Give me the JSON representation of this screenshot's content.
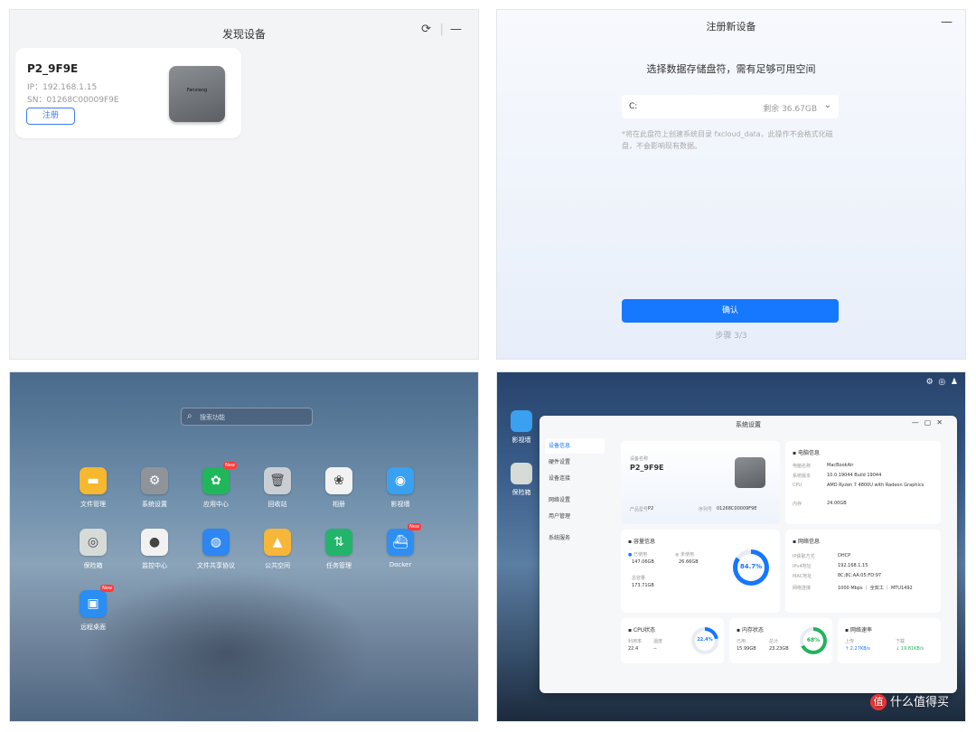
{
  "discover": {
    "title": "发现设备",
    "device_name": "P2_9F9E",
    "ip": "IP：192.168.1.15",
    "sn": "SN：01268C00009F9E",
    "register_label": "注册",
    "device_brand": "Fanxiang"
  },
  "register": {
    "title": "注册新设备",
    "prompt": "选择数据存储盘符，需有足够可用空间",
    "drive": "C:",
    "remaining": "剩余 36.67GB",
    "note": "*将在此盘符上创建系统目录 fxcloud_data，此操作不会格式化磁盘，不会影响现有数据。",
    "confirm_label": "确认",
    "step": "步骤 3/3"
  },
  "launcher": {
    "search_placeholder": "搜索功能",
    "apps": [
      {
        "label": "文件管理",
        "color": "#f5b82e",
        "glyph": "▬"
      },
      {
        "label": "系统设置",
        "color": "#8f949b",
        "glyph": "⚙"
      },
      {
        "label": "应用中心",
        "color": "#1fb75a",
        "glyph": "✿",
        "badge": "New"
      },
      {
        "label": "回收站",
        "color": "#c9ced5",
        "glyph": "🗑"
      },
      {
        "label": "相册",
        "color": "#f2f2f2",
        "glyph": "❀"
      },
      {
        "label": "影视墙",
        "color": "#3aa0f0",
        "glyph": "◉"
      },
      {
        "label": "保险箱",
        "color": "#d6dbd8",
        "glyph": "◎"
      },
      {
        "label": "监控中心",
        "color": "#f1f1f1",
        "glyph": "●"
      },
      {
        "label": "文件共享协议",
        "color": "#2e86f0",
        "glyph": "◍"
      },
      {
        "label": "公共空间",
        "color": "#f6b63a",
        "glyph": "▲"
      },
      {
        "label": "任务管理",
        "color": "#23b36b",
        "glyph": "⇅"
      },
      {
        "label": "Docker",
        "color": "#2e8ff0",
        "glyph": "⛴",
        "badge": "New"
      },
      {
        "label": "远程桌面",
        "color": "#2a8ef2",
        "glyph": "▣",
        "badge": "New"
      }
    ]
  },
  "settings": {
    "desktop_icons": [
      {
        "label": "影视墙",
        "color": "#3aa0f0"
      },
      {
        "label": "保险箱",
        "color": "#d6dbd8"
      }
    ],
    "window_title": "系统设置",
    "nav": [
      "设备信息",
      "硬件设置",
      "设备连接",
      "网络设置",
      "用户管理",
      "系统服务"
    ],
    "device": {
      "label": "设备名称",
      "name": "P2_9F9E",
      "model_label": "产品型号",
      "model": "P2",
      "serial_label": "序列号",
      "serial": "01268C00009F9E"
    },
    "computer": {
      "title": "电脑信息",
      "rows": [
        {
          "k": "电脑名称",
          "v": "MacBookAir"
        },
        {
          "k": "系统版本",
          "v": "10.0.19044 Build 19044"
        },
        {
          "k": "CPU",
          "v": "AMD Ryzen 7 4800U with Radeon Graphics"
        },
        {
          "k": "内存",
          "v": "24.00GB"
        }
      ]
    },
    "storage": {
      "title": "容量信息",
      "used_label": "已使用",
      "used": "147.06GB",
      "free_label": "未使用",
      "free": "26.66GB",
      "total_label": "总容量",
      "total": "173.71GB",
      "percent_text": "84.7%",
      "percent": 84.7
    },
    "network": {
      "title": "网络信息",
      "rows": [
        {
          "k": "IP获取方式",
          "v": "DHCP"
        },
        {
          "k": "IPv4地址",
          "v": "192.168.1.15"
        },
        {
          "k": "MAC地址",
          "v": "8C:8C:AA:05:FD:97"
        },
        {
          "k": "网络连接",
          "v": "1000 Mbps ｜ 全双工 ｜ MTU1492"
        }
      ]
    },
    "cpu": {
      "title": "CPU状态",
      "freq_label": "利用率",
      "freq": "22.4",
      "temp_label": "温度",
      "temp": "--",
      "percent_text": "22.4%",
      "percent": 22.4
    },
    "memory": {
      "title": "内存状态",
      "used_label": "已用",
      "used": "15.99GB",
      "total_label": "总计",
      "total": "23.23GB",
      "percent_text": "68%",
      "percent": 68
    },
    "speed": {
      "title": "网络速率",
      "up_label": "上传",
      "up": "↑ 2.27KB/s",
      "down_label": "下载",
      "down": "↓ 19.81KB/s"
    }
  },
  "watermark": "什么值得买",
  "colors": {
    "accent": "#1677ff",
    "storage_ring": "#1677ff",
    "cpu_ring": "#1677ff",
    "mem_ring": "#22b35e"
  }
}
